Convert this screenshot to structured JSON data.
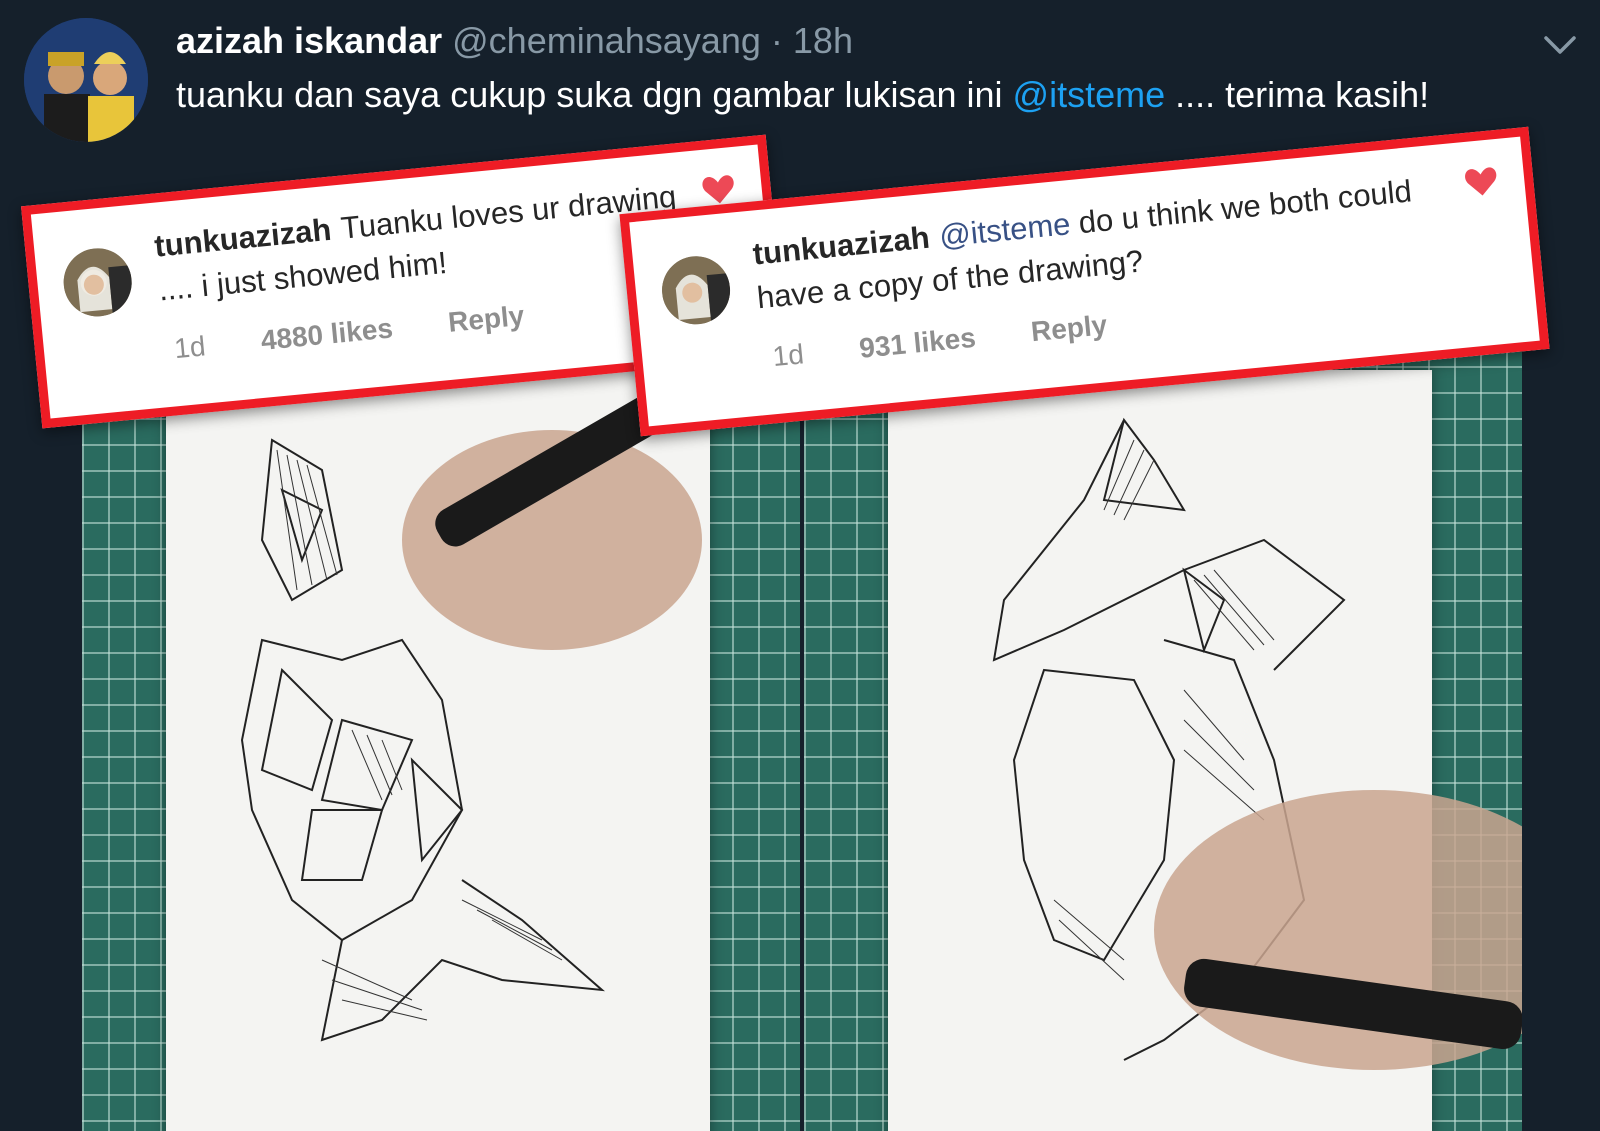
{
  "tweet": {
    "name": "azizah iskandar",
    "handle": "@cheminahsayang",
    "dot": "·",
    "time": "18h",
    "text_before": "tuanku dan saya cukup suka dgn gambar lukisan ini ",
    "mention": "@itsteme",
    "text_after": " .... terima kasih!"
  },
  "comments": [
    {
      "username": "tunkuazizah",
      "mention": "",
      "text": "Tuanku loves ur drawing .... i just showed him!",
      "age": "1d",
      "likes": "4880 likes",
      "reply": "Reply",
      "liked": true
    },
    {
      "username": "tunkuazizah",
      "mention": "@itsteme",
      "text": " do u think we both could have a copy of the drawing?",
      "age": "1d",
      "likes": "931 likes",
      "reply": "Reply",
      "liked": true
    }
  ],
  "colors": {
    "background": "#15202b",
    "accent_link": "#1da1f2",
    "highlight_border": "#ee1c25",
    "heart": "#ed4956"
  },
  "icons": {
    "more": "chevron-down-icon",
    "like": "heart-icon"
  }
}
